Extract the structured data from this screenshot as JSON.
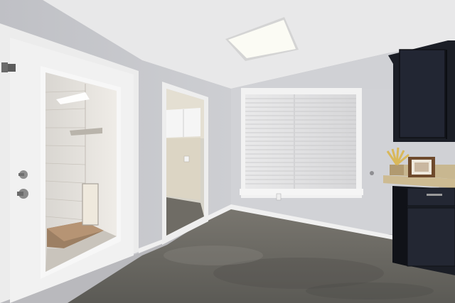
{
  "scene": {
    "description_tags": [
      "interior",
      "room",
      "door",
      "window",
      "cabinets"
    ],
    "colors": {
      "ceiling": "#e9e9ea",
      "left_wall": "#c7c8cc",
      "back_wall": "#d2d3d6",
      "trim": "#f2f2f2",
      "floor": "#6c6b66",
      "cabinet": "#1c1f27",
      "counter": "#c9b893",
      "blind": "#e3e3e4",
      "light_panel": "#fbfbf5"
    }
  }
}
